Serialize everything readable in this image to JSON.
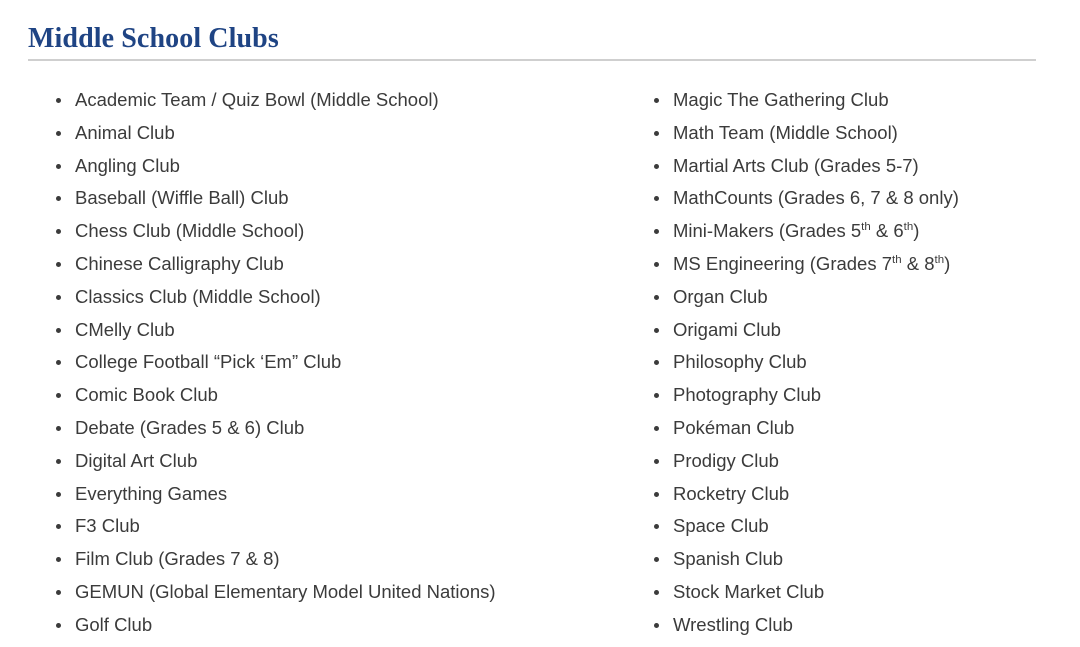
{
  "page": {
    "title": "Middle School Clubs",
    "title_color": "#1f4484",
    "rule_color": "#cfcfcf",
    "text_color": "#3b3b3b",
    "background_color": "#ffffff"
  },
  "columns": [
    {
      "name": "left-column",
      "items": [
        {
          "text": "Academic Team / Quiz Bowl (Middle School)"
        },
        {
          "text": "Animal Club"
        },
        {
          "text": "Angling Club"
        },
        {
          "text": "Baseball (Wiffle Ball) Club"
        },
        {
          "text": "Chess Club (Middle School)"
        },
        {
          "text": "Chinese Calligraphy Club"
        },
        {
          "text": "Classics Club (Middle School)"
        },
        {
          "text": "CMelly Club"
        },
        {
          "text": "College Football “Pick ‘Em” Club"
        },
        {
          "text": "Comic Book Club"
        },
        {
          "text": "Debate (Grades 5 & 6) Club"
        },
        {
          "text": "Digital Art Club"
        },
        {
          "text": "Everything Games"
        },
        {
          "text": "F3 Club"
        },
        {
          "text": "Film Club (Grades 7 & 8)"
        },
        {
          "text": "GEMUN  (Global Elementary Model United Nations)"
        },
        {
          "text": "Golf Club"
        }
      ]
    },
    {
      "name": "right-column",
      "items": [
        {
          "text": "Magic The Gathering Club"
        },
        {
          "text": "Math Team (Middle School)"
        },
        {
          "text": "Martial Arts Club (Grades 5-7)"
        },
        {
          "text": "MathCounts (Grades 6, 7 & 8 only)"
        },
        {
          "html": "Mini-Makers (Grades 5<sup>th</sup> & 6<sup>th</sup>)",
          "text": "Mini-Makers (Grades 5th & 6th)"
        },
        {
          "html": "MS Engineering (Grades 7<sup>th</sup> & 8<sup>th</sup>)",
          "text": "MS Engineering (Grades 7th & 8th)"
        },
        {
          "text": "Organ Club"
        },
        {
          "text": "Origami Club"
        },
        {
          "text": "Philosophy Club"
        },
        {
          "text": "Photography Club"
        },
        {
          "text": "Pokéman Club"
        },
        {
          "text": "Prodigy Club"
        },
        {
          "text": "Rocketry Club"
        },
        {
          "text": "Space Club"
        },
        {
          "text": "Spanish Club"
        },
        {
          "text": "Stock Market Club"
        },
        {
          "text": "Wrestling Club"
        }
      ]
    }
  ]
}
